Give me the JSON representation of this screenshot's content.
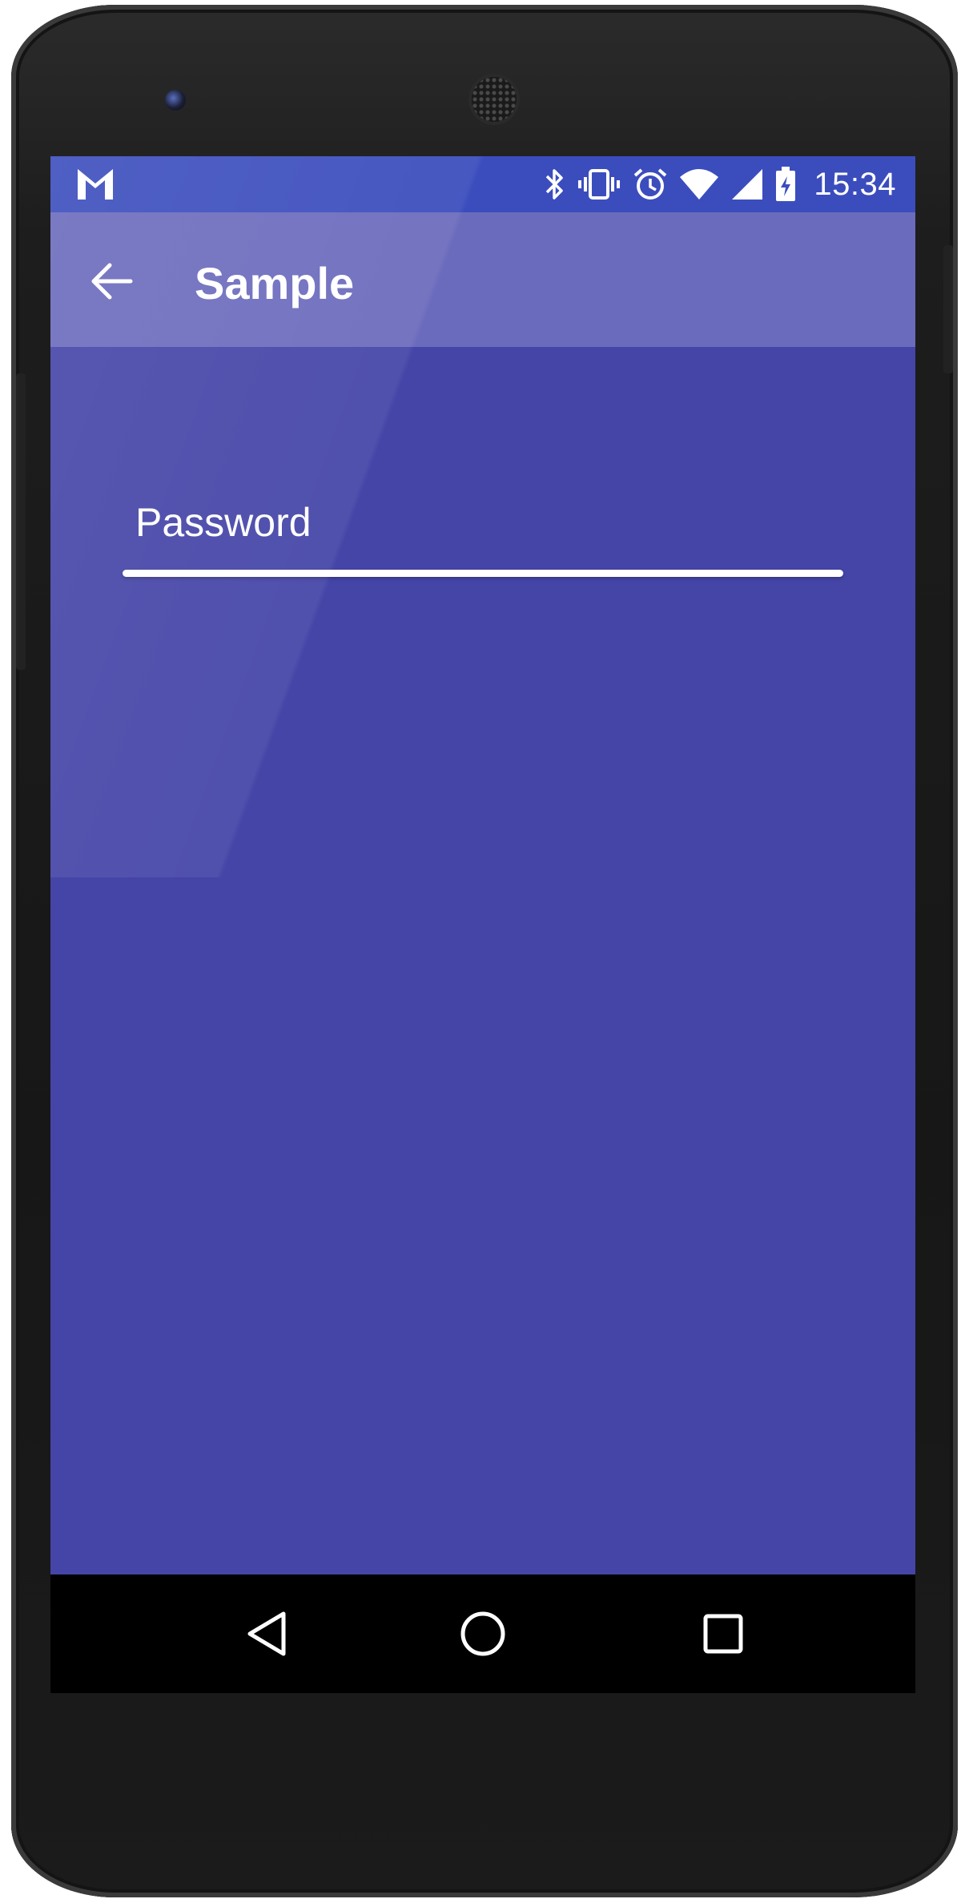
{
  "status_bar": {
    "time": "15:34",
    "icons": [
      "gmail-icon",
      "bluetooth-icon",
      "vibrate-icon",
      "alarm-icon",
      "wifi-icon",
      "cell-signal-icon",
      "battery-charging-icon"
    ]
  },
  "app_bar": {
    "title": "Sample",
    "back_icon": "arrow-back-icon"
  },
  "form": {
    "password_label": "Password",
    "password_value": ""
  },
  "nav_bar": {
    "icons": [
      "nav-back-icon",
      "nav-home-icon",
      "nav-recents-icon"
    ]
  },
  "colors": {
    "primary": "#4545a8",
    "app_bar": "#6b6bbd",
    "status_bar": "#3b4dbd"
  }
}
